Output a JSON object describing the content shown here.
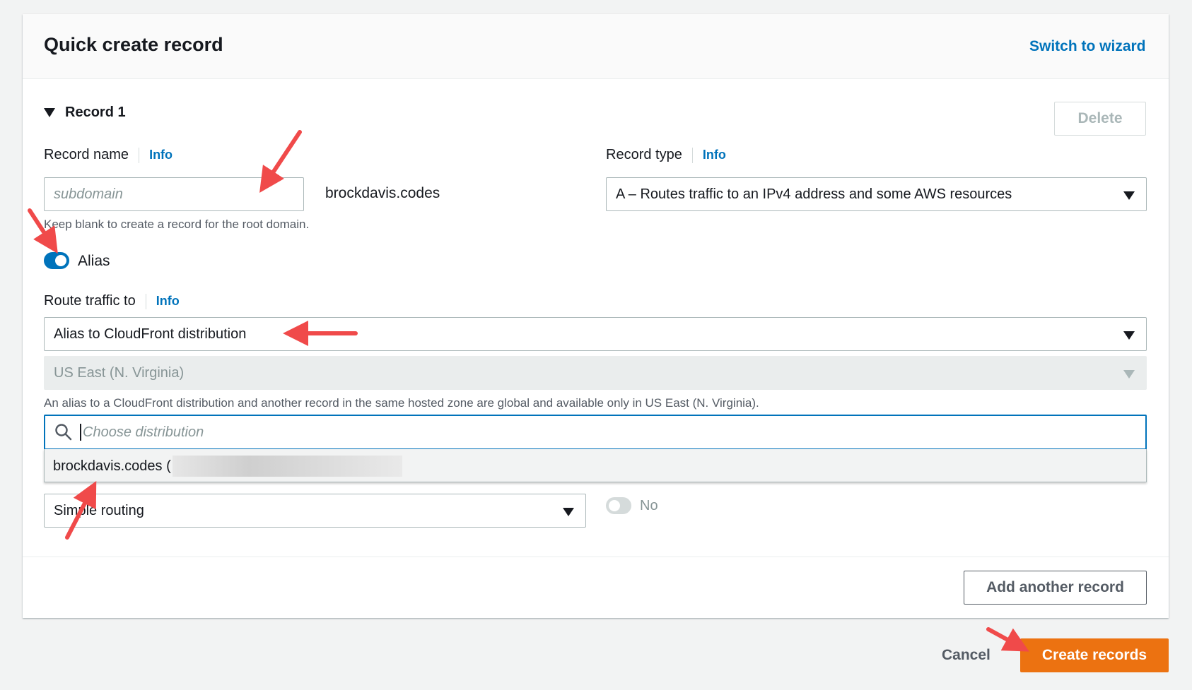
{
  "header": {
    "title": "Quick create record",
    "switch_link": "Switch to wizard"
  },
  "record": {
    "toggle_label": "Record 1",
    "delete_label": "Delete",
    "name_label": "Record name",
    "info": "Info",
    "name_placeholder": "subdomain",
    "domain_suffix": "brockdavis.codes",
    "name_hint": "Keep blank to create a record for the root domain.",
    "type_label": "Record type",
    "type_value": "A – Routes traffic to an IPv4 address and some AWS resources",
    "alias_label": "Alias",
    "alias_enabled": true,
    "route_label": "Route traffic to",
    "route_value": "Alias to CloudFront distribution",
    "region_value": "US East (N. Virginia)",
    "region_hint": "An alias to a CloudFront distribution and another record in the same hosted zone are global and available only in US East (N. Virginia).",
    "distribution_placeholder": "Choose distribution",
    "distribution_option": "brockdavis.codes (",
    "routing_value": "Simple routing",
    "health_toggle_label": "No",
    "health_enabled": false
  },
  "actions": {
    "add_record": "Add another record",
    "cancel": "Cancel",
    "create": "Create records"
  },
  "colors": {
    "accent": "#0073bb",
    "primary_button": "#ec7211",
    "annotation_arrow": "#f04a4a"
  }
}
